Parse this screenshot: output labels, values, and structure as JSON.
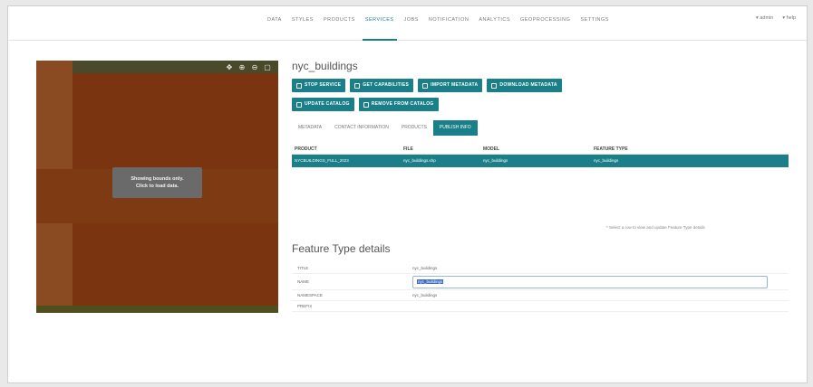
{
  "topnav": {
    "items": [
      {
        "label": "DATA",
        "active": false
      },
      {
        "label": "STYLES",
        "active": false
      },
      {
        "label": "PRODUCTS",
        "active": false
      },
      {
        "label": "SERVICES",
        "active": true
      },
      {
        "label": "JOBS",
        "active": false
      },
      {
        "label": "NOTIFICATION",
        "active": false
      },
      {
        "label": "ANALYTICS",
        "active": false
      },
      {
        "label": "GEOPROCESSING",
        "active": false
      },
      {
        "label": "SETTINGS",
        "active": false
      }
    ],
    "user": "▾ admin",
    "help": "▾ help"
  },
  "map": {
    "overlay_line1": "Showing bounds only.",
    "overlay_line2": "Click to load data."
  },
  "service": {
    "title": "nyc_buildings",
    "buttons_row1": [
      "STOP SERVICE",
      "GET CAPABILITIES",
      "IMPORT METADATA",
      "DOWNLOAD METADATA"
    ],
    "buttons_row2": [
      "UPDATE CATALOG",
      "REMOVE FROM CATALOG"
    ]
  },
  "subtabs": [
    {
      "label": "METADATA",
      "active": false
    },
    {
      "label": "CONTACT INFORMATION",
      "active": false
    },
    {
      "label": "PRODUCTS",
      "active": false
    },
    {
      "label": "PUBLISH INFO",
      "active": true
    }
  ],
  "table": {
    "headers": [
      "PRODUCT",
      "FILE",
      "MODEL",
      "FEATURE TYPE"
    ],
    "rows": [
      [
        "NYCBUILDINGS_FULL_2023",
        "nyc_buildings.shp",
        "nyc_buildings",
        "nyc_buildings"
      ]
    ]
  },
  "hint": "* Select a row to view and update Feature Type details",
  "feature_details": {
    "title": "Feature Type details",
    "fields": [
      {
        "label": "TITLE",
        "value": "nyc_buildings"
      },
      {
        "label": "NAME",
        "value": "nyc_buildings"
      },
      {
        "label": "NAMESPACE",
        "value": "nyc_buildings"
      },
      {
        "label": "PREFIX",
        "value": ""
      }
    ]
  },
  "colors": {
    "accent": "#1a7f88",
    "map": "#7b3410"
  }
}
